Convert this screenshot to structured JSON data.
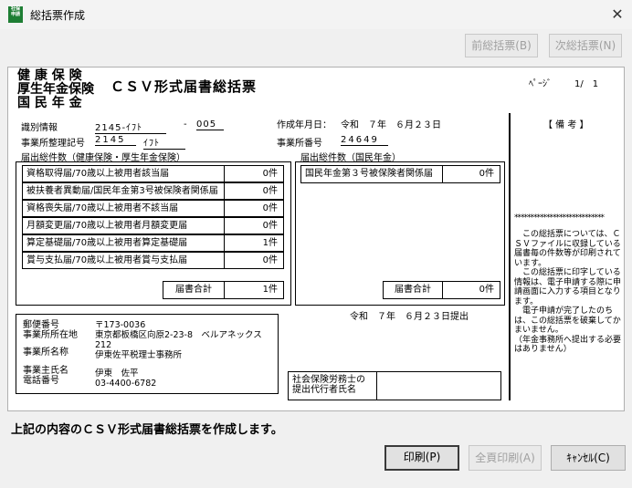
{
  "window": {
    "title": "総括票作成",
    "icon_text": "社保\n申請"
  },
  "toolbar": {
    "prev_label": "前総括票(B)",
    "next_label": "次総括票(N)"
  },
  "form": {
    "insurance_lines": [
      "健 康 保 険",
      "厚生年金保険",
      "国 民 年 金"
    ],
    "form_title": "ＣＳＶ形式届書総括票",
    "page_label": "ﾍﾟｰｼﾞ",
    "page_value": "1/　1",
    "id_label": "識別情報",
    "id_value1": "2145-ｲﾌﾄ",
    "id_sep": "-",
    "id_value2": "005",
    "created_label": "作成年月日：",
    "created_value": "令和　７年　６月２３日",
    "office_mgmt_label": "事業所整理記号",
    "office_mgmt_value1": "2145",
    "office_mgmt_value2": "ｲﾌﾄ",
    "office_num_label": "事業所番号",
    "office_num_value": "24649",
    "left_header": "届出総件数（健康保険・厚生年金保険）",
    "right_header": "届出総件数（国民年金）",
    "left_rows": [
      {
        "label": "資格取得届/70歳以上被用者該当届",
        "count": "0件"
      },
      {
        "label": "被扶養者異動届/国民年金第3号被保険者関係届",
        "count": "0件"
      },
      {
        "label": "資格喪失届/70歳以上被用者不該当届",
        "count": "0件"
      },
      {
        "label": "月額変更届/70歳以上被用者月額変更届",
        "count": "0件"
      },
      {
        "label": "算定基礎届/70歳以上被用者算定基礎届",
        "count": "1件"
      },
      {
        "label": "賞与支払届/70歳以上被用者賞与支払届",
        "count": "0件"
      }
    ],
    "left_total_label": "届書合計",
    "left_total_value": "1件",
    "right_rows": [
      {
        "label": "国民年金第３号被保険者関係届",
        "count": "0件"
      }
    ],
    "right_total_label": "届書合計",
    "right_total_value": "0件",
    "submit_date": "令和　７年　６月２３日提出",
    "addr_labels": [
      "郵便番号",
      "事業所所在地",
      "事業所名称",
      "事業主氏名",
      "電話番号"
    ],
    "postal": "〒173-0036",
    "address1": "東京都板橋区向原2-23-8　ベルアネックス",
    "address2": "212",
    "office_name": "伊東佐平税理士事務所",
    "owner_name": "伊東　佐平",
    "phone": "03-4400-6782",
    "agent_label1": "社会保険労務士の",
    "agent_label2": "提出代行者氏名",
    "notes_title": "【 備 考 】",
    "notes_stars": "****************************",
    "notes_body": "　この総括票については、ＣＳＶファイルに収録している届書毎の件数等が印刷されています。\n　この総括票に印字している情報は、電子申請する際に申請画面に入力する項目となります。\n　電子申請が完了したのちは、この総括票を破棄してかまいません。\n（年金事務所へ提出する必要はありません）"
  },
  "message": "上記の内容のＣＳＶ形式届書総括票を作成します。",
  "buttons": {
    "print": "印刷(P)",
    "print_all": "全頁印刷(A)",
    "cancel": "ｷｬﾝｾﾙ(C)"
  }
}
